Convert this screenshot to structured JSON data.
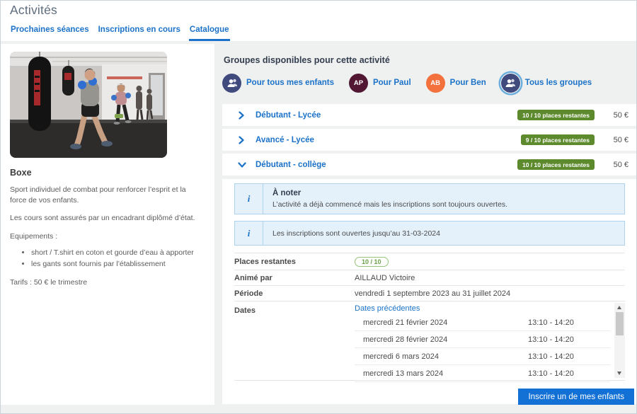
{
  "header": {
    "title": "Activités",
    "tabs": [
      {
        "label": "Prochaines séances"
      },
      {
        "label": "Inscriptions en cours"
      },
      {
        "label": "Catalogue"
      }
    ]
  },
  "activity": {
    "name": "Boxe",
    "description1": "Sport individuel de combat pour renforcer l’esprit et la force de vos enfants.",
    "description2": "Les cours sont assurés par un encadrant diplômé d’état.",
    "equipment_title": "Equipements :",
    "equipment_items": [
      "short / T.shirt en coton et gourde d’eau à apporter",
      "les gants sont fournis par l’établissement"
    ],
    "tarifs": "Tarifs : 50 € le trimestre"
  },
  "groups": {
    "title": "Groupes disponibles pour cette activité",
    "filters": [
      {
        "label": "Pour tous mes enfants",
        "initials": ""
      },
      {
        "label": "Pour Paul",
        "initials": "AP"
      },
      {
        "label": "Pour Ben",
        "initials": "AB"
      },
      {
        "label": "Tous les groupes",
        "initials": ""
      }
    ],
    "rows": [
      {
        "name": "Débutant - Lycée",
        "badge": "10 / 10 places restantes",
        "price": "50 €"
      },
      {
        "name": "Avancé - Lycée",
        "badge": "9 / 10 places restantes",
        "price": "50 €"
      },
      {
        "name": "Débutant - collège",
        "badge": "10 / 10 places restantes",
        "price": "50 €"
      }
    ]
  },
  "details": {
    "note1_title": "À noter",
    "note1_text": "L’activité a déjà commencé mais les inscriptions sont toujours ouvertes.",
    "note2_text": "Les inscriptions sont ouvertes jusqu’au 31-03-2024",
    "places_label": "Places restantes",
    "places_value": "10 / 10",
    "animator_label": "Animé par",
    "animator_value": "AILLAUD Victoire",
    "period_label": "Période",
    "period_value": "vendredi 1 septembre 2023 au 31 juillet 2024",
    "dates_label": "Dates",
    "previous_dates_link": "Dates précédentes",
    "sessions": [
      {
        "date": "mercredi 21 février 2024",
        "time": "13:10 - 14:20"
      },
      {
        "date": "mercredi 28 février 2024",
        "time": "13:10 - 14:20"
      },
      {
        "date": "mercredi 6 mars 2024",
        "time": "13:10 - 14:20"
      },
      {
        "date": "mercredi 13 mars 2024",
        "time": "13:10 - 14:20"
      }
    ],
    "enroll_button": "Inscrire un de mes enfants"
  },
  "colors": {
    "accent_blue": "#1b72c8",
    "button_blue": "#1371d6",
    "badge_green": "#5c8a2c",
    "pill_green": "#6da04b",
    "avatar_navy": "#404a7c",
    "avatar_maroon": "#511733",
    "avatar_orange": "#f2713c",
    "selected_ring": "#6aaede",
    "info_box_bg": "#e4f1fb",
    "heading_navy": "#333e4e",
    "title_gray": "#5d6c7c"
  }
}
